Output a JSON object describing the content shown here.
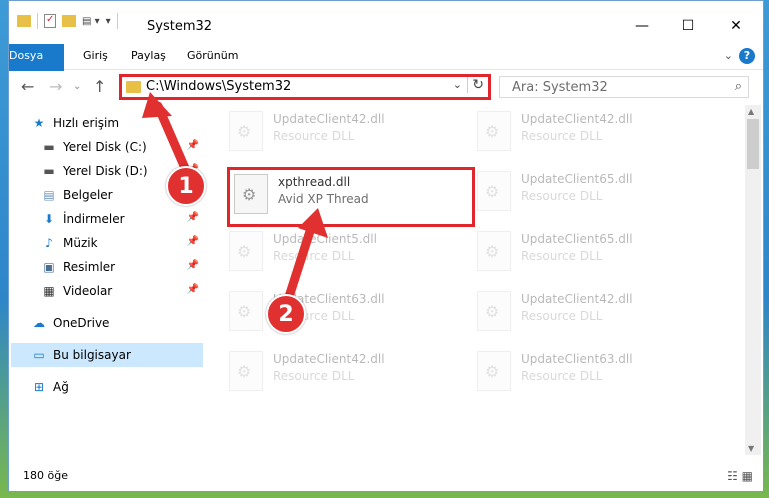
{
  "window": {
    "title": "System32"
  },
  "ribbon": {
    "tabs": [
      "Dosya",
      "Giriş",
      "Paylaş",
      "Görünüm"
    ]
  },
  "address": {
    "path": "C:\\Windows\\System32"
  },
  "search": {
    "placeholder": "Ara: System32"
  },
  "sidebar": {
    "items": [
      {
        "label": "Hızlı erişim",
        "icon": "star-icon"
      },
      {
        "label": "Yerel Disk (C:)",
        "icon": "drive-icon"
      },
      {
        "label": "Yerel Disk (D:)",
        "icon": "drive-icon"
      },
      {
        "label": "Belgeler",
        "icon": "documents-icon"
      },
      {
        "label": "İndirmeler",
        "icon": "download-icon"
      },
      {
        "label": "Müzik",
        "icon": "music-icon"
      },
      {
        "label": "Resimler",
        "icon": "pictures-icon"
      },
      {
        "label": "Videolar",
        "icon": "videos-icon"
      },
      {
        "label": "OneDrive",
        "icon": "cloud-icon"
      },
      {
        "label": "Bu bilgisayar",
        "icon": "computer-icon"
      },
      {
        "label": "Ağ",
        "icon": "network-icon"
      }
    ]
  },
  "files": [
    {
      "name": "UpdateClient42.dll",
      "type": "Resource DLL"
    },
    {
      "name": "UpdateClient42.dll",
      "type": "Resource DLL"
    },
    {
      "name": "xpthread.dll",
      "type": "Avid XP Thread"
    },
    {
      "name": "UpdateClient65.dll",
      "type": "Resource DLL"
    },
    {
      "name": "UpdateClient5.dll",
      "type": "Resource DLL"
    },
    {
      "name": "UpdateClient65.dll",
      "type": "Resource DLL"
    },
    {
      "name": "UpdateClient63.dll",
      "type": "Resource DLL"
    },
    {
      "name": "UpdateClient42.dll",
      "type": "Resource DLL"
    },
    {
      "name": "UpdateClient42.dll",
      "type": "Resource DLL"
    },
    {
      "name": "UpdateClient63.dll",
      "type": "Resource DLL"
    }
  ],
  "status": {
    "count": "180 öğe"
  },
  "annotations": {
    "step1": "1",
    "step2": "2"
  },
  "colors": {
    "accent": "#1979ca",
    "highlight": "#e0262a",
    "selected": "#cce8ff"
  }
}
